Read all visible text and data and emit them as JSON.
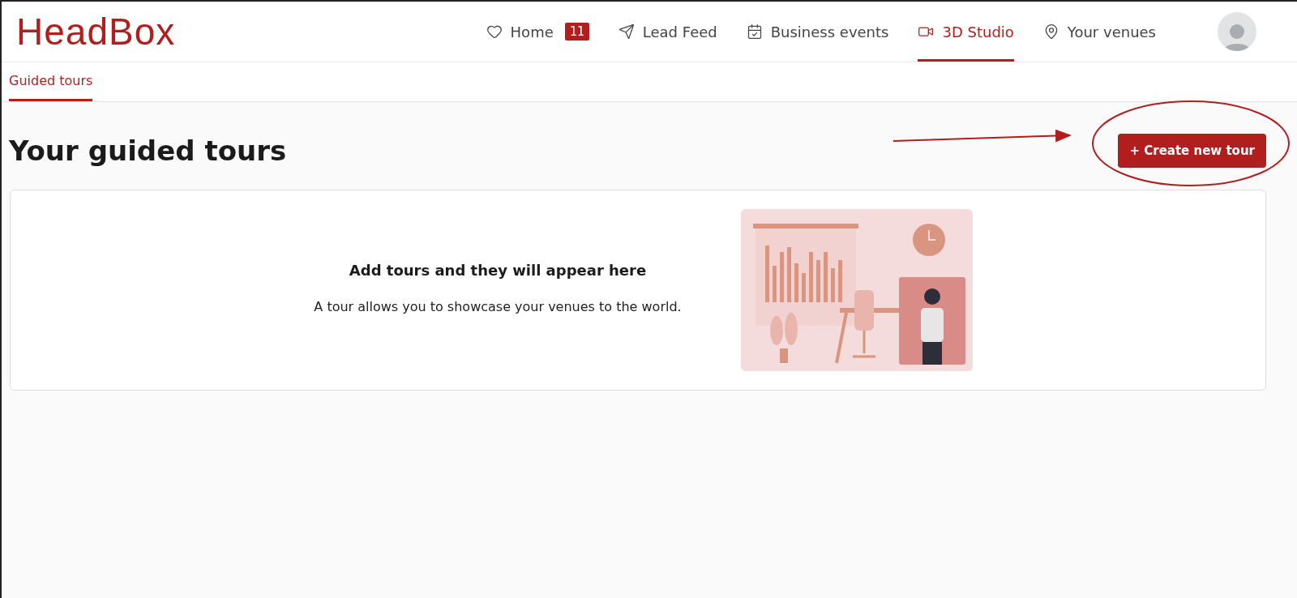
{
  "logo": "HeadBox",
  "nav": [
    {
      "label": "Home",
      "badge": "11",
      "selected": false
    },
    {
      "label": "Lead Feed",
      "selected": false
    },
    {
      "label": "Business events",
      "selected": false
    },
    {
      "label": "3D Studio",
      "selected": true
    },
    {
      "label": "Your venues",
      "selected": false
    }
  ],
  "subtabs": [
    {
      "label": "Guided tours",
      "selected": true
    }
  ],
  "page": {
    "title": "Your guided tours",
    "button": "+ Create new tour"
  },
  "empty_state": {
    "heading": "Add tours and they will appear here",
    "text": "A tour allows you to showcase your venues to the world."
  }
}
